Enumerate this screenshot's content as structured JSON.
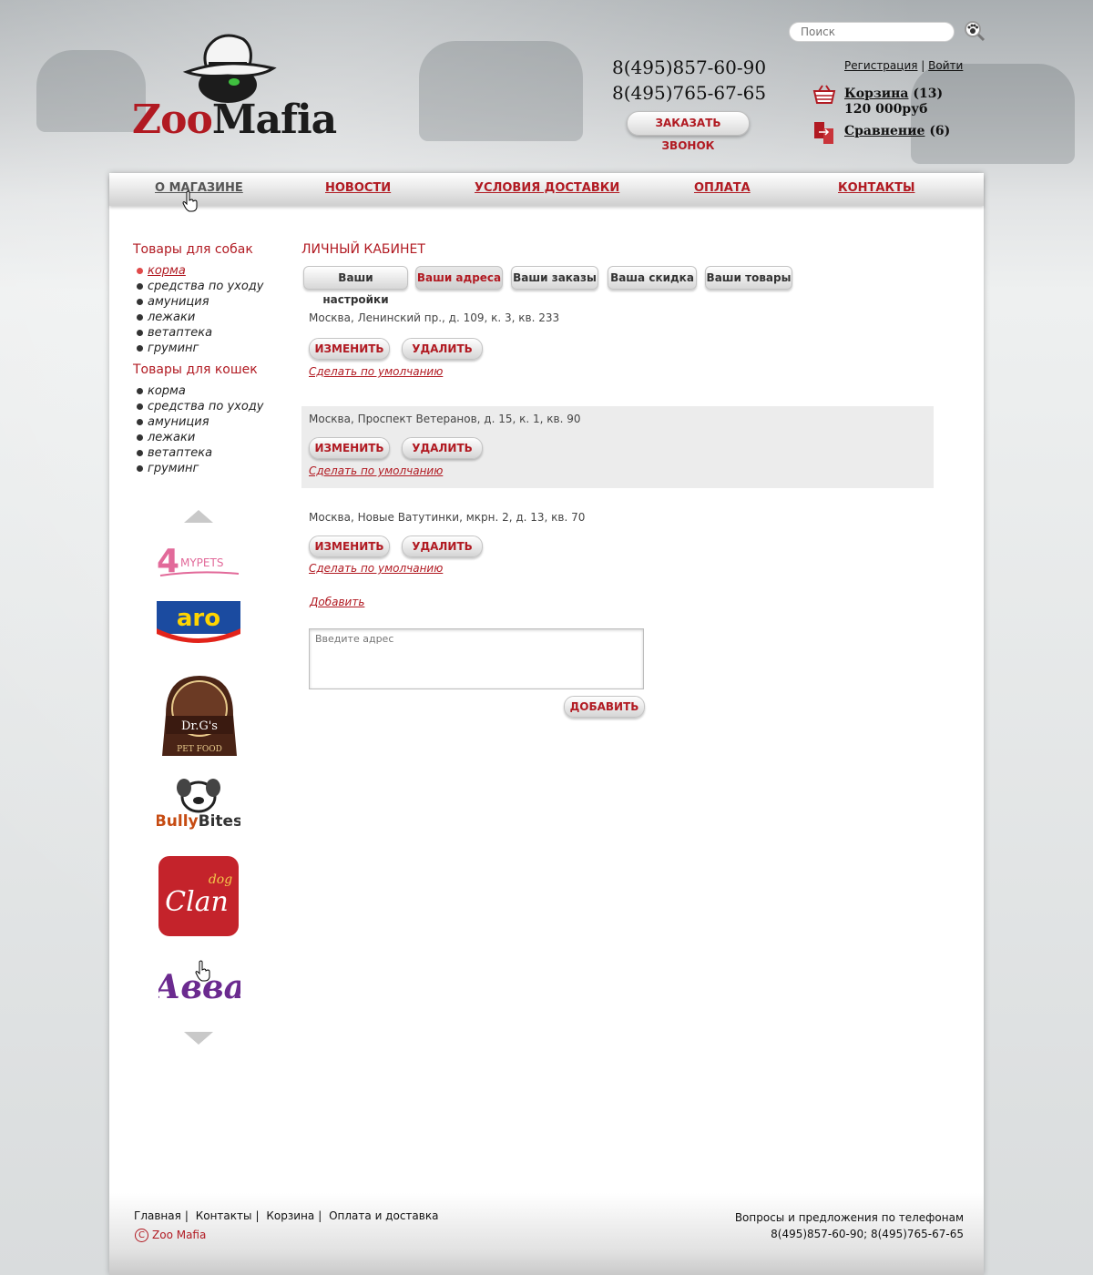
{
  "header": {
    "logo_zoo": "Zoo",
    "logo_mafia": "Mafia",
    "phones": [
      "8(495)857-60-90",
      "8(495)765-67-65"
    ],
    "callback_label": "ЗАКАЗАТЬ ЗВОНОК",
    "search_placeholder": "Поиск",
    "register_label": "Регистрация",
    "login_label": "Войти",
    "auth_separator": "|",
    "cart_label": "Корзина",
    "cart_count": "(13)",
    "cart_total": "120 000руб",
    "compare_label": "Сравнение",
    "compare_count": "(6)"
  },
  "nav": {
    "items": [
      {
        "label": "О МАГАЗИНЕ"
      },
      {
        "label": "НОВОСТИ"
      },
      {
        "label": "УСЛОВИЯ ДОСТАВКИ"
      },
      {
        "label": "ОПЛАТА"
      },
      {
        "label": "КОНТАКТЫ"
      }
    ]
  },
  "sidebar": {
    "dogs_title": "Товары для собак",
    "dogs_items": [
      "корма",
      "средства по уходу",
      "амуниция",
      "лежаки",
      "ветаптека",
      "груминг"
    ],
    "cats_title": "Товары для кошек",
    "cats_items": [
      "корма",
      "средства по уходу",
      "амуниция",
      "лежаки",
      "ветаптека",
      "груминг"
    ],
    "brands": [
      "4MYPETS",
      "aro",
      "Dr.G's Fresh Pet Food",
      "Bully Bites",
      "Clan dog",
      "Авва"
    ]
  },
  "content": {
    "title": "ЛИЧНЫЙ КАБИНЕТ",
    "tabs": [
      "Ваши настройки",
      "Ваши адреса",
      "Ваши заказы",
      "Ваша скидка",
      "Ваши товары"
    ],
    "addresses": [
      "Москва, Ленинский пр., д. 109, к. 3, кв. 233",
      "Москва, Проспект Ветеранов, д. 15, к. 1, кв. 90",
      "Москва, Новые Ватутинки, мкрн. 2, д. 13, кв. 70"
    ],
    "edit_label": "ИЗМЕНИТЬ",
    "delete_label": "УДАЛИТЬ",
    "default_label": "Сделать по умолчанию",
    "add_link": "Добавить",
    "address_placeholder": "Введите адрес",
    "add_button": "ДОБАВИТЬ"
  },
  "footer": {
    "links": [
      "Главная",
      "Контакты",
      "Корзина",
      "Оплата и доставка"
    ],
    "copyright": "Zoo Mafia",
    "contacts_line1": "Вопросы и предложения по телефонам",
    "contacts_line2": "8(495)857-60-90; 8(495)765-67-65"
  },
  "colors": {
    "accent": "#b11a22",
    "shaded_row": "#ececec"
  }
}
